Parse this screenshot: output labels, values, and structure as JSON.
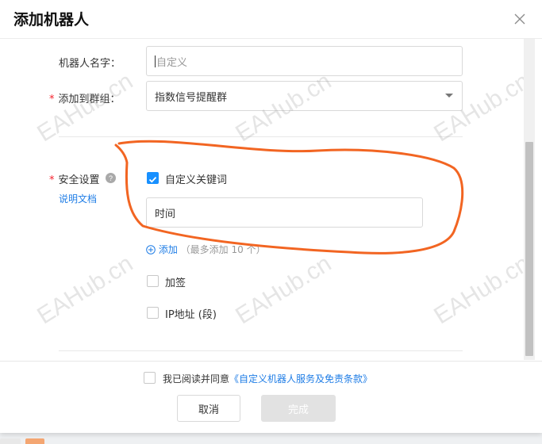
{
  "dialog": {
    "title": "添加机器人",
    "close_icon": "close-icon"
  },
  "form": {
    "robot_name": {
      "label": "机器人名字：",
      "placeholder": "自定义",
      "value": ""
    },
    "group": {
      "label": "添加到群组：",
      "selected": "指数信号提醒群"
    },
    "security": {
      "label": "安全设置",
      "help_icon": "question-circle-icon",
      "doc_link": "说明文档",
      "options": {
        "custom_keyword": {
          "label": "自定义关键词",
          "checked": true
        },
        "keyword_value": "时间",
        "add_link": "添加",
        "add_hint": "（最多添加 10 个）",
        "sign": {
          "label": "加签",
          "checked": false
        },
        "ip": {
          "label": "IP地址 (段)",
          "checked": false
        }
      }
    }
  },
  "footer": {
    "agree_text": "我已阅读并同意",
    "agree_link": "《自定义机器人服务及免责条款》",
    "agree_checked": false,
    "cancel": "取消",
    "done": "完成"
  },
  "watermark": "EAHub.cn",
  "colors": {
    "primary": "#1890ff",
    "link": "#1f7de6",
    "required": "#f5222d",
    "annotation": "#f26522"
  }
}
